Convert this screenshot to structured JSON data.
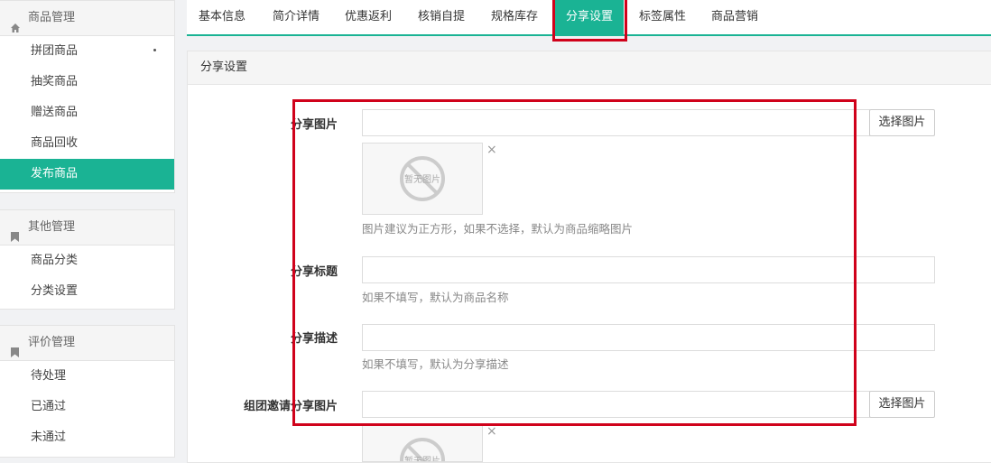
{
  "sidebar": {
    "groups": [
      {
        "title": "商品管理",
        "icon": "home-icon",
        "items": [
          "拼团商品",
          "抽奖商品",
          "赠送商品",
          "商品回收",
          "发布商品"
        ],
        "active": 4
      },
      {
        "title": "其他管理",
        "icon": "bookmark-icon",
        "items": [
          "商品分类",
          "分类设置"
        ]
      },
      {
        "title": "评价管理",
        "icon": "bookmark-icon",
        "items": [
          "待处理",
          "已通过",
          "未通过"
        ]
      }
    ]
  },
  "tabs": [
    "基本信息",
    "简介详情",
    "优惠返利",
    "核销自提",
    "规格库存",
    "分享设置",
    "标签属性",
    "商品营销"
  ],
  "active_tab": "分享设置",
  "panel": {
    "title": "分享设置",
    "share_image": {
      "label": "分享图片",
      "value": "",
      "button": "选择图片",
      "placeholder_text": "暂无图片",
      "hint": "图片建议为正方形，如果不选择，默认为商品缩略图片"
    },
    "share_title": {
      "label": "分享标题",
      "value": "",
      "hint": "如果不填写，默认为商品名称"
    },
    "share_desc": {
      "label": "分享描述",
      "value": "",
      "hint": "如果不填写，默认为分享描述"
    },
    "group_invite_image": {
      "label": "组团邀请分享图片",
      "value": "",
      "button": "选择图片",
      "placeholder_text": "暂无图片"
    }
  },
  "colors": {
    "accent": "#1ab394",
    "highlight": "#d0021b"
  }
}
